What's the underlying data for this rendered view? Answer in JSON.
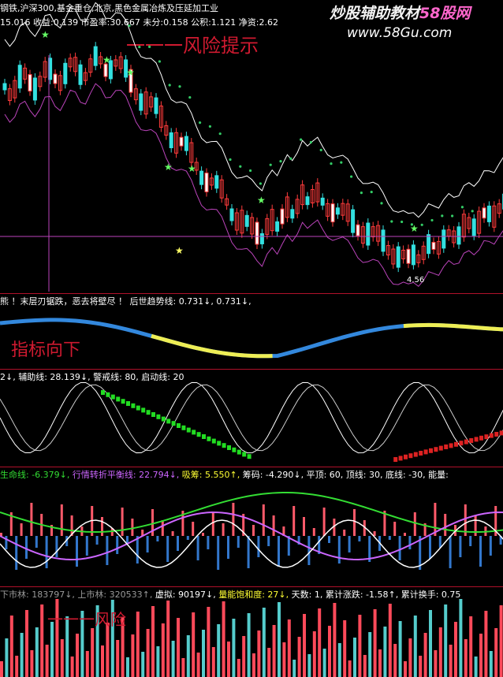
{
  "header": {
    "tags": "钢铁,沪深300,基金重仓,北京,黑色金属冶炼及压延加工业",
    "values": "15.016  收益:0.139  市盈率:30.667  未分:0.158  公积:1.121  净资:2.62",
    "watermark_cn": "炒股辅助教材",
    "watermark_brand": "58股网",
    "watermark_url": "www.58Gu.com",
    "handwritten_note": "一一一风险提示"
  },
  "price_panel": {
    "low_label": "4.56",
    "colors": {
      "up": "#ff3b3b",
      "down": "#33e0e0",
      "bull_bar": "#ffffff",
      "star": "#66ff66",
      "dots": "#33cc66"
    }
  },
  "indicator1": {
    "title": "熊 ！末层刃锯跌，恶去将壁尽 ！ 后世趋势线: 0.731↓, 0.731↓,",
    "handwritten_note": "指标向下"
  },
  "indicator2": {
    "title": "2↓, 辅助线: 28.139↓, 警戒线: 80, 启动线: 20"
  },
  "indicator3": {
    "title": "生命线: -6.379↓, 行情转折平衡线: 22.794↓, 吸筹: 5.550↑, 筹码: -4.290↓, 平顶: 60, 顶线: 30, 底线: -30, 能量:",
    "segments": [
      {
        "text": "生命线: -6.379↓,",
        "color": "#33dd33"
      },
      {
        "text": " 行情转折平衡线: 22.794↓,",
        "color": "#cc66ff"
      },
      {
        "text": " 吸筹: 5.550↑,",
        "color": "#ffff33"
      },
      {
        "text": " 筹码: -4.290↓,",
        "color": "#ffffff"
      },
      {
        "text": " 平顶: 60,",
        "color": "#ffffff"
      },
      {
        "text": " 顶线: 30,",
        "color": "#ffffff"
      },
      {
        "text": " 底线: -30,",
        "color": "#ffffff"
      },
      {
        "text": " 能量:",
        "color": "#ffffff"
      }
    ]
  },
  "volume_panel": {
    "segments": [
      {
        "text": "下市林: 183797↓,",
        "color": "#999999"
      },
      {
        "text": " 上市林: 320533↑,",
        "color": "#999999"
      },
      {
        "text": " 虚拟: 90197↓,",
        "color": "#ffffff"
      },
      {
        "text": " 量能饱和度: 27↓,",
        "color": "#ffff33"
      },
      {
        "text": " 天数: 1,",
        "color": "#ffffff"
      },
      {
        "text": " 累计涨跌: -1.58↑,",
        "color": "#ffffff"
      },
      {
        "text": " 累计换手: 0.75",
        "color": "#ffffff"
      }
    ],
    "handwritten_note": "一一一风险"
  }
}
